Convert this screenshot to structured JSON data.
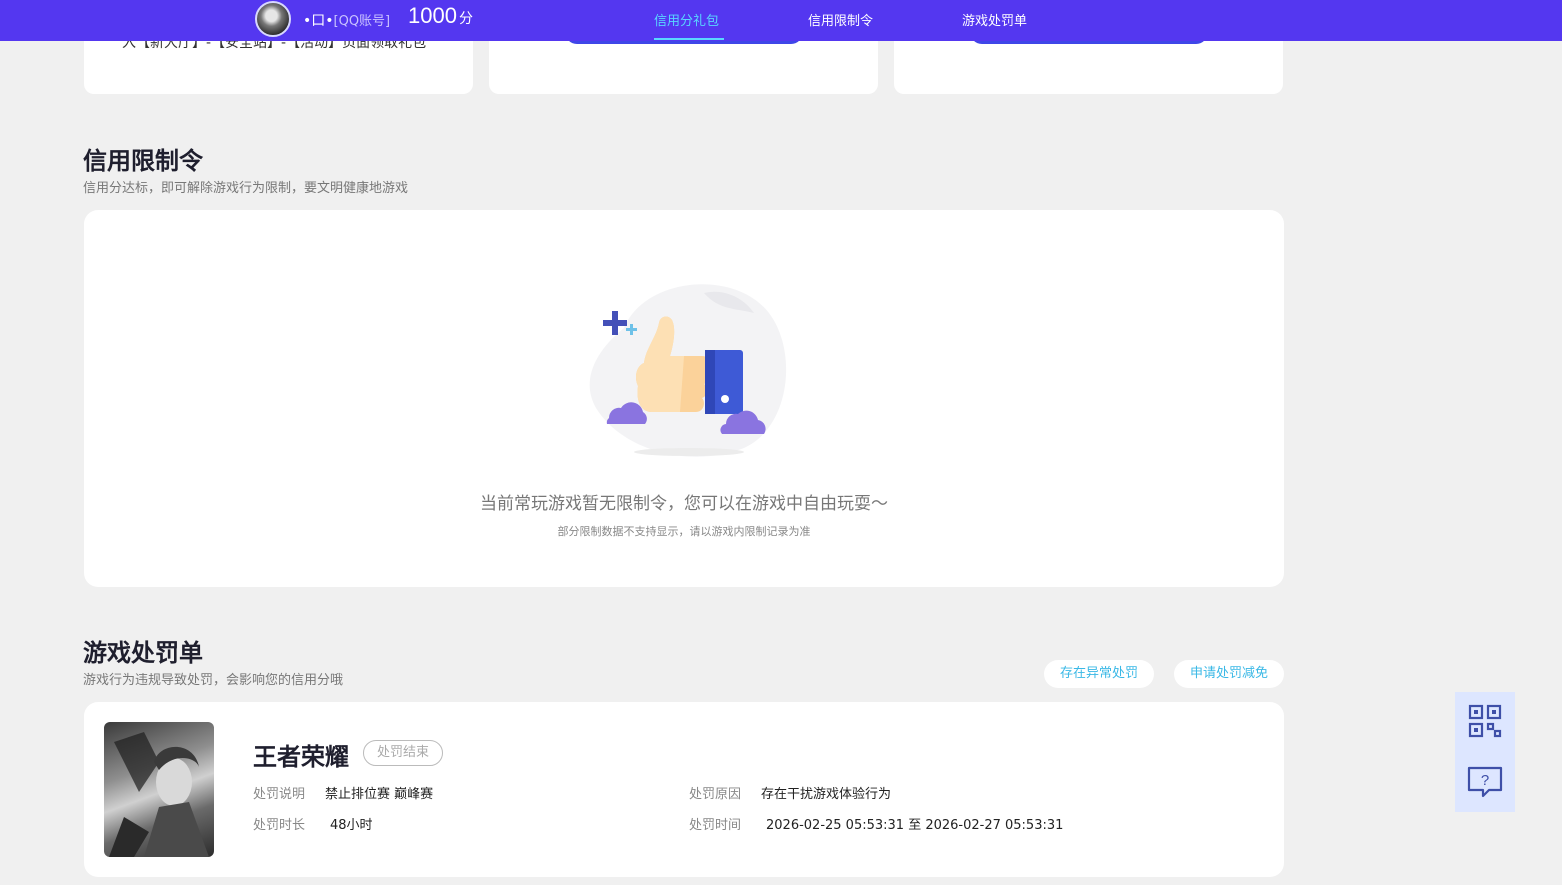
{
  "topbar": {
    "nickname": "•口•",
    "account_tag": "[QQ账号]",
    "score": "1000",
    "score_unit": "分",
    "tabs": [
      {
        "label": "信用分礼包",
        "active": true
      },
      {
        "label": "信用限制令",
        "active": false
      },
      {
        "label": "游戏处罚单",
        "active": false
      }
    ],
    "accent_color": "#5437f0",
    "active_tab_color": "#59d7ff"
  },
  "top_cards": {
    "first_card_text": "入【新大厅】-【安全站】-【活动】页面领取礼包"
  },
  "restriction": {
    "title": "信用限制令",
    "subtitle": "信用分达标，即可解除游戏行为限制，要文明健康地游戏",
    "empty_main": "当前常玩游戏暂无限制令，您可以在游戏中自由玩耍～",
    "empty_sub": "部分限制数据不支持显示，请以游戏内限制记录为准",
    "illustration_icon": "thumbs-up-icon"
  },
  "penalty": {
    "title": "游戏处罚单",
    "subtitle": "游戏行为违规导致处罚，会影响您的信用分哦",
    "abnormal_button": "存在异常处罚",
    "appeal_button": "申请处罚减免",
    "record": {
      "game": "王者荣耀",
      "status": "处罚结束",
      "desc_label": "处罚说明",
      "desc_value": "禁止排位赛 巅峰赛",
      "duration_label": "处罚时长",
      "duration_value": "48小时",
      "reason_label": "处罚原因",
      "reason_value": "存在干扰游戏体验行为",
      "time_label": "处罚时间",
      "time_value": "2026-02-25 05:53:31 至 2026-02-27 05:53:31"
    }
  },
  "float_tools": {
    "qr_icon": "qrcode-icon",
    "help_icon": "help-chat-icon"
  }
}
